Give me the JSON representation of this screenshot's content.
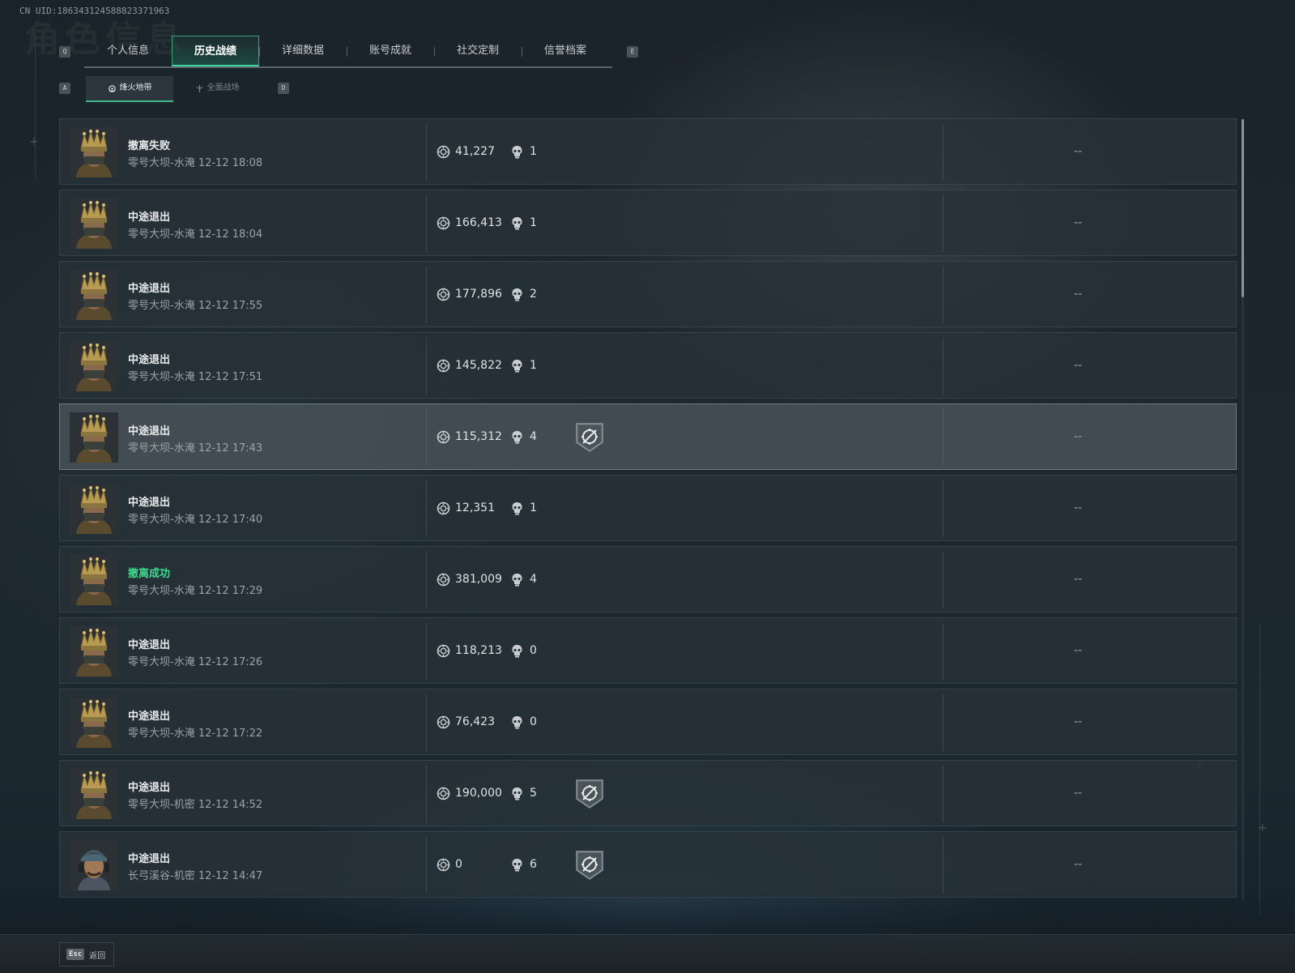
{
  "uid_text": "CN UID:186343124588823371963",
  "ghost_title": "角色信息",
  "tabs": {
    "prev_key": "Q",
    "next_key": "E",
    "items": [
      {
        "label": "个人信息"
      },
      {
        "label": "历史战绩",
        "active": true
      },
      {
        "label": "详细数据"
      },
      {
        "label": "账号成就"
      },
      {
        "label": "社交定制"
      },
      {
        "label": "信誉档案"
      }
    ]
  },
  "subtabs": {
    "prev_key": "A",
    "next_key": "D",
    "items": [
      {
        "label": "烽火地带",
        "icon": "fire-zone-icon",
        "active": true
      },
      {
        "label": "全面战场",
        "icon": "battlefield-icon"
      }
    ]
  },
  "matches": [
    {
      "status": "撤离失败",
      "map": "零号大坝-水淹 12-12 18:08",
      "value": "41,227",
      "kills": "1",
      "badge": false,
      "extra": "--",
      "avatar": "crown-helmet"
    },
    {
      "status": "中途退出",
      "map": "零号大坝-水淹 12-12 18:04",
      "value": "166,413",
      "kills": "1",
      "badge": false,
      "extra": "--",
      "avatar": "crown-helmet"
    },
    {
      "status": "中途退出",
      "map": "零号大坝-水淹 12-12 17:55",
      "value": "177,896",
      "kills": "2",
      "badge": false,
      "extra": "--",
      "avatar": "crown-helmet"
    },
    {
      "status": "中途退出",
      "map": "零号大坝-水淹 12-12 17:51",
      "value": "145,822",
      "kills": "1",
      "badge": false,
      "extra": "--",
      "avatar": "crown-helmet"
    },
    {
      "status": "中途退出",
      "map": "零号大坝-水淹 12-12 17:43",
      "value": "115,312",
      "kills": "4",
      "badge": true,
      "extra": "--",
      "avatar": "crown-helmet",
      "highlight": true
    },
    {
      "status": "中途退出",
      "map": "零号大坝-水淹 12-12 17:40",
      "value": "12,351",
      "kills": "1",
      "badge": false,
      "extra": "--",
      "avatar": "crown-helmet"
    },
    {
      "status": "撤离成功",
      "map": "零号大坝-水淹 12-12 17:29",
      "value": "381,009",
      "kills": "4",
      "badge": false,
      "extra": "--",
      "avatar": "crown-helmet",
      "success": true
    },
    {
      "status": "中途退出",
      "map": "零号大坝-水淹 12-12 17:26",
      "value": "118,213",
      "kills": "0",
      "badge": false,
      "extra": "--",
      "avatar": "crown-helmet"
    },
    {
      "status": "中途退出",
      "map": "零号大坝-水淹 12-12 17:22",
      "value": "76,423",
      "kills": "0",
      "badge": false,
      "extra": "--",
      "avatar": "crown-helmet"
    },
    {
      "status": "中途退出",
      "map": "零号大坝-机密 12-12 14:52",
      "value": "190,000",
      "kills": "5",
      "badge": true,
      "extra": "--",
      "avatar": "crown-helmet"
    },
    {
      "status": "中途退出",
      "map": "长弓溪谷-机密 12-12 14:47",
      "value": "0",
      "kills": "6",
      "badge": true,
      "extra": "--",
      "avatar": "headset-soldier"
    }
  ],
  "footer": {
    "key": "Esc",
    "label": "返回"
  },
  "colors": {
    "accent": "#3fd79a",
    "success": "#3ddc8f"
  }
}
